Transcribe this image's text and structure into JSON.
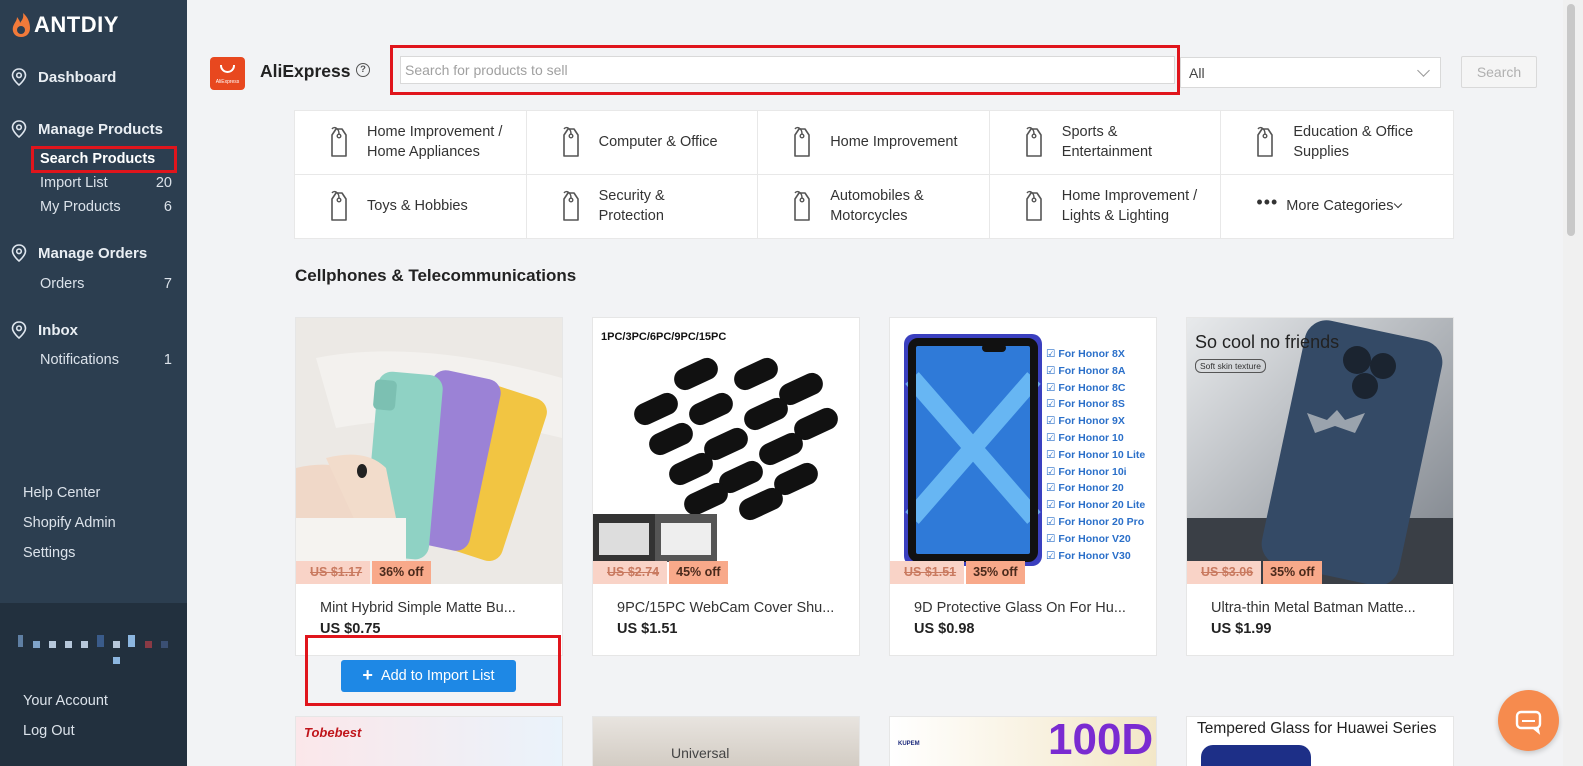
{
  "app": {
    "logo_text": "ANTDIY"
  },
  "sidebar": {
    "sections": [
      {
        "title": "Dashboard",
        "items": []
      },
      {
        "title": "Manage Products",
        "items": [
          {
            "label": "Search Products",
            "count": "",
            "active": true
          },
          {
            "label": "Import List",
            "count": "20"
          },
          {
            "label": "My Products",
            "count": "6"
          }
        ]
      },
      {
        "title": "Manage Orders",
        "items": [
          {
            "label": "Orders",
            "count": "7"
          }
        ]
      },
      {
        "title": "Inbox",
        "items": [
          {
            "label": "Notifications",
            "count": "1"
          }
        ]
      }
    ],
    "footer_links": [
      "Help Center",
      "Shopify Admin",
      "Settings"
    ],
    "account_links": [
      "Your Account",
      "Log Out"
    ]
  },
  "header": {
    "source_name": "AliExpress",
    "logo_caption": "AliExpress",
    "search_placeholder": "Search for products to sell",
    "category_select": "All",
    "search_button": "Search"
  },
  "categories": [
    "Home Improvement / Home Appliances",
    "Computer & Office",
    "Home Improvement",
    "Sports & Entertainment",
    "Education & Office Supplies",
    "Toys & Hobbies",
    "Security & Protection",
    "Automobiles & Motorcycles",
    "Home Improvement / Lights & Lighting"
  ],
  "more_categories": "More Categories",
  "section": {
    "title": "Cellphones & Telecommunications"
  },
  "products": [
    {
      "title": "Mint Hybrid Simple Matte Bu...",
      "price": "US $0.75",
      "old_price": "US $1.17",
      "discount": "36% off"
    },
    {
      "title": "9PC/15PC WebCam Cover Shu...",
      "price": "US $1.51",
      "old_price": "US $2.74",
      "discount": "45% off",
      "image_text": "1PC/3PC/6PC/9PC/15PC"
    },
    {
      "title": "9D Protective Glass On For Hu...",
      "price": "US $0.98",
      "old_price": "US $1.51",
      "discount": "35% off",
      "image_list": [
        "For Honor 8X",
        "For Honor 8A",
        "For Honor 8C",
        "For Honor 8S",
        "For Honor 9X",
        "For Honor 10",
        "For Honor 10 Lite",
        "For Honor 10i",
        "For Honor 20",
        "For Honor 20 Lite",
        "For Honor 20 Pro",
        "For Honor V20",
        "For Honor V30"
      ]
    },
    {
      "title": "Ultra-thin Metal Batman Matte...",
      "price": "US $1.99",
      "old_price": "US $3.06",
      "discount": "35% off",
      "image_text": "So cool no friends",
      "image_subtext": "Soft skin texture"
    }
  ],
  "add_button": "Add to Import List",
  "next_row": {
    "card1_text": "Tobebest",
    "card2_text": "Universal",
    "card3_text": "100D",
    "card3_brand": "KUPEM",
    "card4_text": "Tempered Glass for Huawei Series"
  },
  "colors": {
    "sidebar_bg": "#2c3e50",
    "highlight_red": "#e0151c",
    "primary_blue": "#1e88e5",
    "aliexpress_orange": "#e8481f",
    "chat_orange": "#f68b4e"
  }
}
